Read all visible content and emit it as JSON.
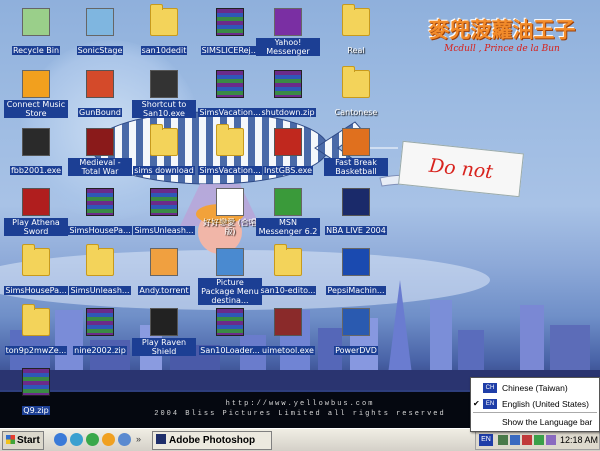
{
  "logo": {
    "title_zh": "麥兜菠蘿油王子",
    "subtitle": "Mcdull , Prince de la Bun"
  },
  "banner": {
    "text": "Do not"
  },
  "watermark": {
    "line1": "http://www.yellowbus.com",
    "line2": "2004 Bliss Pictures Limited all rights reserved"
  },
  "desktop_icons": [
    {
      "label": "Recycle Bin",
      "kind": "gen",
      "color": "#9acf8a"
    },
    {
      "label": "SonicStage",
      "kind": "gen",
      "color": "#7fb6e0"
    },
    {
      "label": "san10dedit",
      "kind": "folder"
    },
    {
      "label": "SIMSLICERej...",
      "kind": "winrar"
    },
    {
      "label": "Yahoo! Messenger",
      "kind": "gen",
      "color": "#7a2fa3"
    },
    {
      "label": "Real",
      "kind": "folder",
      "plain": true
    },
    {
      "label": "Connect Music Store",
      "kind": "gen",
      "color": "#f2a01e"
    },
    {
      "label": "GunBound",
      "kind": "exe",
      "color": "#d44a2a"
    },
    {
      "label": "Shortcut to San10.exe",
      "kind": "exe",
      "color": "#333333"
    },
    {
      "label": "SimsVacation...",
      "kind": "winrar"
    },
    {
      "label": "shutdown.zip",
      "kind": "winrar"
    },
    {
      "label": "Cantonese",
      "kind": "folder",
      "plain": true
    },
    {
      "label": "fbb2001.exe",
      "kind": "exe",
      "color": "#2a2a2a"
    },
    {
      "label": "Medieval - Total War",
      "kind": "exe",
      "color": "#8a1a1a"
    },
    {
      "label": "sims download",
      "kind": "folder"
    },
    {
      "label": "SimsVacation...",
      "kind": "folder"
    },
    {
      "label": "InstGBS.exe",
      "kind": "exe",
      "color": "#c0281e"
    },
    {
      "label": "Fast Break Basketball",
      "kind": "gen",
      "color": "#e0701e"
    },
    {
      "label": "Play Athena Sword",
      "kind": "exe",
      "color": "#b01e1e"
    },
    {
      "label": "SimsHousePa...",
      "kind": "winrar"
    },
    {
      "label": "SimsUnleash...",
      "kind": "winrar"
    },
    {
      "label": "好好戀愛 (合唱版)",
      "kind": "gen",
      "color": "#ffffff",
      "plain": true
    },
    {
      "label": "MSN Messenger 6.2",
      "kind": "gen",
      "color": "#3a9a3a"
    },
    {
      "label": "NBA LIVE 2004",
      "kind": "exe",
      "color": "#1a2a6a"
    },
    {
      "label": "SimsHousePa...",
      "kind": "folder"
    },
    {
      "label": "SimsUnleash...",
      "kind": "folder"
    },
    {
      "label": "Andy.torrent",
      "kind": "gen",
      "color": "#f0a040"
    },
    {
      "label": "Picture Package Menu destina...",
      "kind": "gen",
      "color": "#4a8ad0"
    },
    {
      "label": "san10-edito...",
      "kind": "folder"
    },
    {
      "label": "PepsiMachin...",
      "kind": "gen",
      "color": "#1a4ab0"
    },
    {
      "label": "ton9p2mwZe...",
      "kind": "folder"
    },
    {
      "label": "nine2002.zip",
      "kind": "winrar"
    },
    {
      "label": "Play Raven Shield",
      "kind": "exe",
      "color": "#222222"
    },
    {
      "label": "San10Loader...",
      "kind": "winrar"
    },
    {
      "label": "uimetool.exe",
      "kind": "exe",
      "color": "#8a2a2a"
    },
    {
      "label": "PowerDVD",
      "kind": "gen",
      "color": "#2a5ab0"
    },
    {
      "label": "Q9.zip",
      "kind": "winrar"
    }
  ],
  "taskbar": {
    "start_label": "Start",
    "task_label": "Adobe Photoshop",
    "lang_indicator": "EN",
    "clock": "12:18 AM"
  },
  "language_menu": {
    "items": [
      {
        "badge": "CH",
        "label": "Chinese (Taiwan)",
        "checked": false
      },
      {
        "badge": "EN",
        "label": "English (United States)",
        "checked": true
      }
    ],
    "show_bar": "Show the Language bar"
  },
  "colors": {
    "label_highlight": "#1c3f94",
    "menu_badge": "#1f3ea8"
  }
}
